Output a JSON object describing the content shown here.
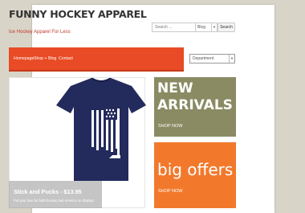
{
  "site": {
    "title": "FUNNY HOCKEY APPAREL",
    "tagline": "Ice Hockey Apparel For Less"
  },
  "search": {
    "placeholder": "Search ...",
    "scope_selected": "Blog",
    "button_label": "Search"
  },
  "nav": {
    "items": [
      {
        "label": "Homepage"
      },
      {
        "label": "Shop +"
      },
      {
        "label": "Blog"
      },
      {
        "label": "Contact"
      }
    ],
    "department_selected": "Department"
  },
  "product": {
    "name": "Stick and Pucks - $13.95",
    "description": "Put your love for both hockey and America on display!"
  },
  "promos": [
    {
      "line1": "NEW",
      "line2": "ARRIVALS",
      "cta": "SHOP NOW"
    },
    {
      "line1": "big offers",
      "cta": "SHOP NOW"
    }
  ],
  "colors": {
    "nav_bg": "#e84b25",
    "promo_new_bg": "#8a8b63",
    "promo_offers_bg": "#f2792c",
    "shirt": "#232a5c"
  }
}
